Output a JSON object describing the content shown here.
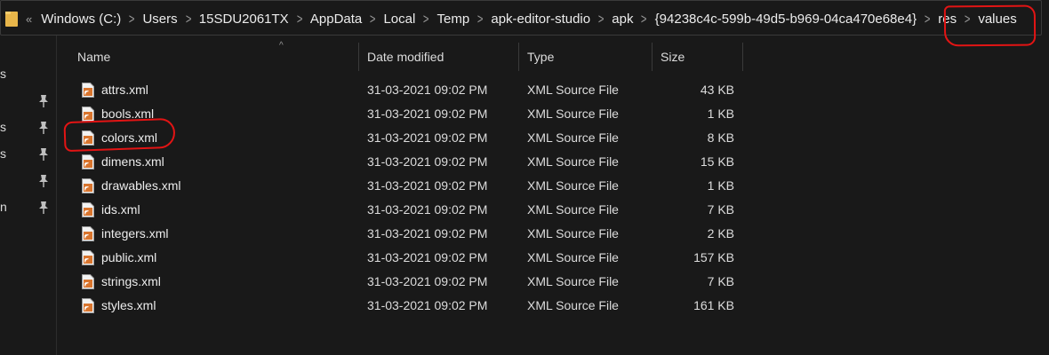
{
  "breadcrumb": {
    "overflow": "«",
    "items": [
      "Windows (C:)",
      "Users",
      "15SDU2061TX",
      "AppData",
      "Local",
      "Temp",
      "apk-editor-studio",
      "apk",
      "{94238c4c-599b-49d5-b969-04ca470e68e4}",
      "res",
      "values"
    ]
  },
  "nav": {
    "fragments": [
      "s",
      "s",
      "s",
      "n"
    ]
  },
  "columns": {
    "name": "Name",
    "date": "Date modified",
    "type": "Type",
    "size": "Size"
  },
  "files": [
    {
      "name": "attrs.xml",
      "date": "31-03-2021 09:02 PM",
      "type": "XML Source File",
      "size": "43 KB"
    },
    {
      "name": "bools.xml",
      "date": "31-03-2021 09:02 PM",
      "type": "XML Source File",
      "size": "1 KB"
    },
    {
      "name": "colors.xml",
      "date": "31-03-2021 09:02 PM",
      "type": "XML Source File",
      "size": "8 KB"
    },
    {
      "name": "dimens.xml",
      "date": "31-03-2021 09:02 PM",
      "type": "XML Source File",
      "size": "15 KB"
    },
    {
      "name": "drawables.xml",
      "date": "31-03-2021 09:02 PM",
      "type": "XML Source File",
      "size": "1 KB"
    },
    {
      "name": "ids.xml",
      "date": "31-03-2021 09:02 PM",
      "type": "XML Source File",
      "size": "7 KB"
    },
    {
      "name": "integers.xml",
      "date": "31-03-2021 09:02 PM",
      "type": "XML Source File",
      "size": "2 KB"
    },
    {
      "name": "public.xml",
      "date": "31-03-2021 09:02 PM",
      "type": "XML Source File",
      "size": "157 KB"
    },
    {
      "name": "strings.xml",
      "date": "31-03-2021 09:02 PM",
      "type": "XML Source File",
      "size": "7 KB"
    },
    {
      "name": "styles.xml",
      "date": "31-03-2021 09:02 PM",
      "type": "XML Source File",
      "size": "161 KB"
    }
  ],
  "colors": {
    "background": "#191919",
    "annotation": "#e21414",
    "folder": "#e8b64a",
    "xml_icon": "#d9752e"
  }
}
